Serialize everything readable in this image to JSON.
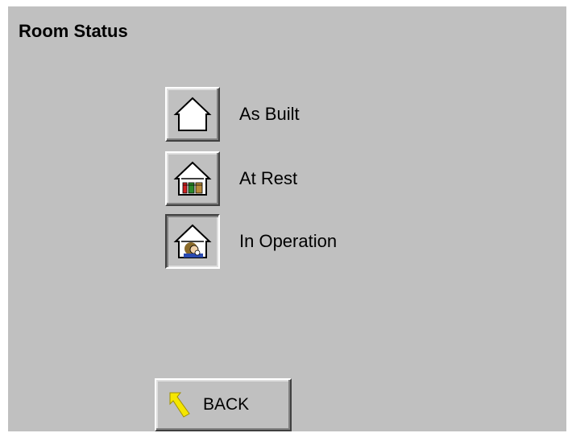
{
  "window": {
    "title": "Room Status"
  },
  "options": [
    {
      "label": "As Built",
      "icon": "house-empty-icon",
      "selected": false
    },
    {
      "label": "At Rest",
      "icon": "house-equipment-icon",
      "selected": false
    },
    {
      "label": "In Operation",
      "icon": "house-person-icon",
      "selected": true
    }
  ],
  "back": {
    "label": "BACK",
    "icon": "back-arrow-icon"
  },
  "colors": {
    "panel": "#c0c0c0",
    "arrow": "#f5e600"
  }
}
